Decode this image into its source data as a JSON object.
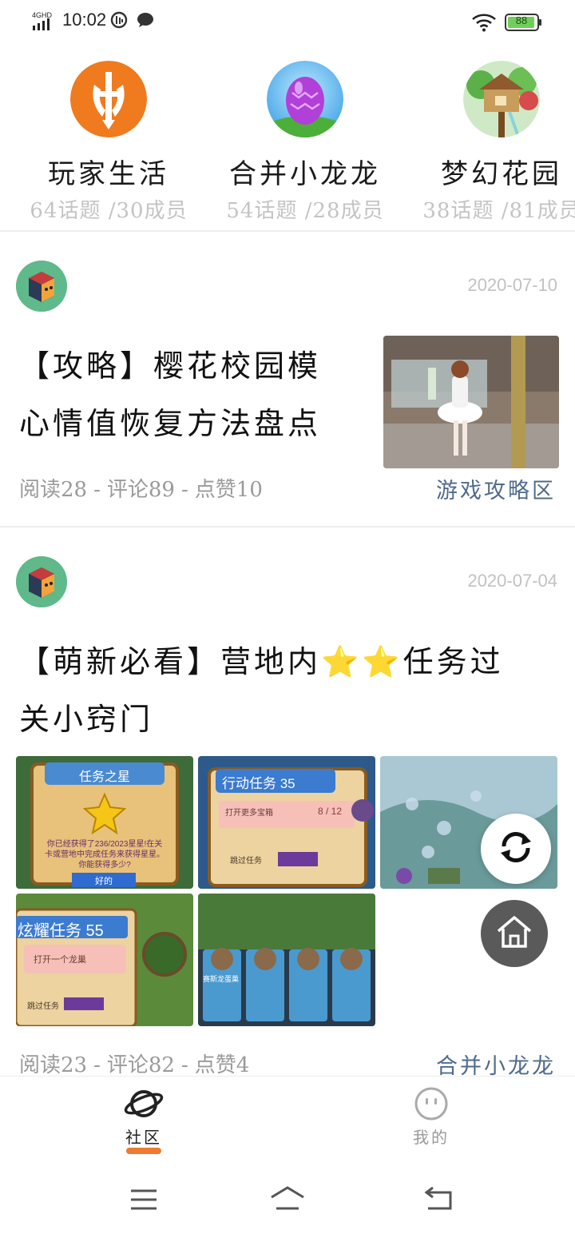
{
  "status_bar": {
    "network": "4GHD",
    "time": "10:02",
    "battery": "88"
  },
  "groups": [
    {
      "name": "玩家生活",
      "stats": "64话题 /30成员"
    },
    {
      "name": "合并小龙龙",
      "stats": "54话题 /28成员"
    },
    {
      "name": "梦幻花园",
      "stats": "38话题 /81成员"
    }
  ],
  "posts": [
    {
      "date": "2020-07-10",
      "title_line1": "【攻略】樱花校园模",
      "title_line2": "心情值恢复方法盘点",
      "reads": "阅读28",
      "comments": "评论89",
      "likes": "点赞10",
      "separator": "-",
      "tag": "游戏攻略区"
    },
    {
      "date": "2020-07-04",
      "title_line1": "【萌新必看】营地内⭐⭐任务过",
      "title_line2": "关小窍门",
      "reads": "阅读23",
      "comments": "评论82",
      "likes": "点赞4",
      "separator": "-",
      "tag": "合并小龙龙",
      "images": [
        {
          "heading": "任务之星",
          "body": "你已经获得了236/2023星星!在关卡或营地中完成任务来获得星星。你能获得多少?",
          "button": "好的"
        },
        {
          "heading": "行动任务 35",
          "body": "打开更多宝箱",
          "counter": "8 / 12",
          "button": "跳过任务"
        },
        {
          "heading": ""
        },
        {
          "heading": "炫耀任务 55",
          "body": "打开一个龙巢",
          "button": "跳过任务"
        },
        {
          "heading": "赛斯龙蛋巢"
        }
      ]
    }
  ],
  "bottom_nav": {
    "community": "社区",
    "mine": "我的"
  },
  "colors": {
    "accent": "#f07a2f",
    "tag": "#4f6b8c",
    "avatar_green": "#5fb98a"
  }
}
